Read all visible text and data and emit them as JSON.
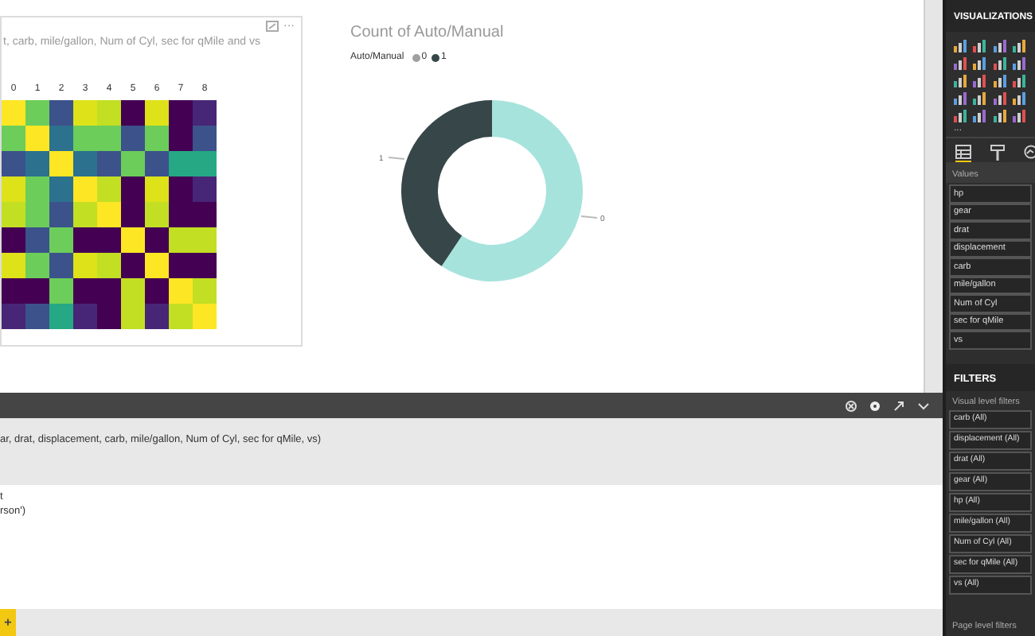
{
  "heatmap_visual": {
    "title": "t, carb, mile/gallon, Num of Cyl, sec for qMile and vs",
    "more": "···",
    "column_labels": [
      "0",
      "1",
      "2",
      "3",
      "4",
      "5",
      "6",
      "7",
      "8"
    ]
  },
  "donut_visual": {
    "legend": {
      "title": "Auto/Manual",
      "items": [
        {
          "label": "0",
          "color": "#a0a0a0"
        },
        {
          "label": "1",
          "color": "#374649"
        }
      ]
    },
    "chart_data": {
      "type": "donut",
      "title": "Count of Auto/Manual",
      "categories": [
        "0",
        "1"
      ],
      "values": [
        59.375,
        40.625
      ]
    }
  },
  "script_editor": {
    "code_lines": [
      "ar, drat, displacement, carb, mile/gallon, Num of Cyl, sec for qMile, vs)"
    ],
    "script_lines": [
      "t",
      "rson')"
    ],
    "add_button": "+"
  },
  "visualizations": {
    "title": "VISUALIZATIONS",
    "more": "...",
    "tabs": [
      {
        "kind": "fields",
        "selected": true
      },
      {
        "kind": "format",
        "selected": false
      },
      {
        "kind": "analytics",
        "selected": false
      }
    ],
    "values_label": "Values",
    "fields": [
      "hp",
      "gear",
      "drat",
      "displacement",
      "carb",
      "mile/gallon",
      "Num of Cyl",
      "sec for qMile",
      "vs"
    ]
  },
  "filters": {
    "title": "FILTERS",
    "visual_level_label": "Visual level filters",
    "items": [
      "carb (All)",
      "displacement (All)",
      "drat (All)",
      "gear (All)",
      "hp (All)",
      "mile/gallon (All)",
      "Num of Cyl (All)",
      "sec for qMile (All)",
      "vs (All)"
    ],
    "page_level_label": "Page level filters"
  }
}
